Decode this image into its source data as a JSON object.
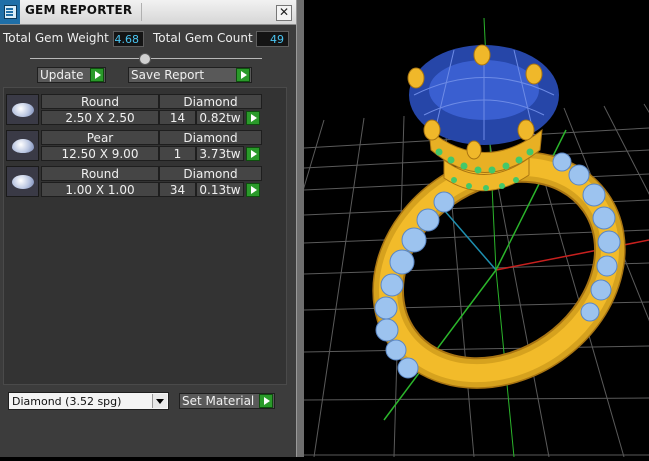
{
  "window": {
    "title": "GEM REPORTER",
    "close_label": "✕"
  },
  "stats": {
    "weight_label": "Total Gem Weight",
    "weight_value": "4.68",
    "count_label": "Total Gem Count",
    "count_value": "49"
  },
  "actions": {
    "update_label": "Update",
    "save_report_label": "Save Report"
  },
  "gems": [
    {
      "shape": "Round",
      "size": "2.50 X 2.50",
      "material": "Diamond",
      "count": "14",
      "weight": "0.82tw"
    },
    {
      "shape": "Pear",
      "size": "12.50 X 9.00",
      "material": "Diamond",
      "count": "1",
      "weight": "3.73tw"
    },
    {
      "shape": "Round",
      "size": "1.00 X 1.00",
      "material": "Diamond",
      "count": "34",
      "weight": "0.13tw"
    }
  ],
  "material_select": {
    "value": "Diamond      (3.52 spg)"
  },
  "set_material_label": "Set Material",
  "colors": {
    "value_text": "#4ac4f0",
    "go_button": "#2a9a2a",
    "panel_bg": "#3c3c3c"
  }
}
